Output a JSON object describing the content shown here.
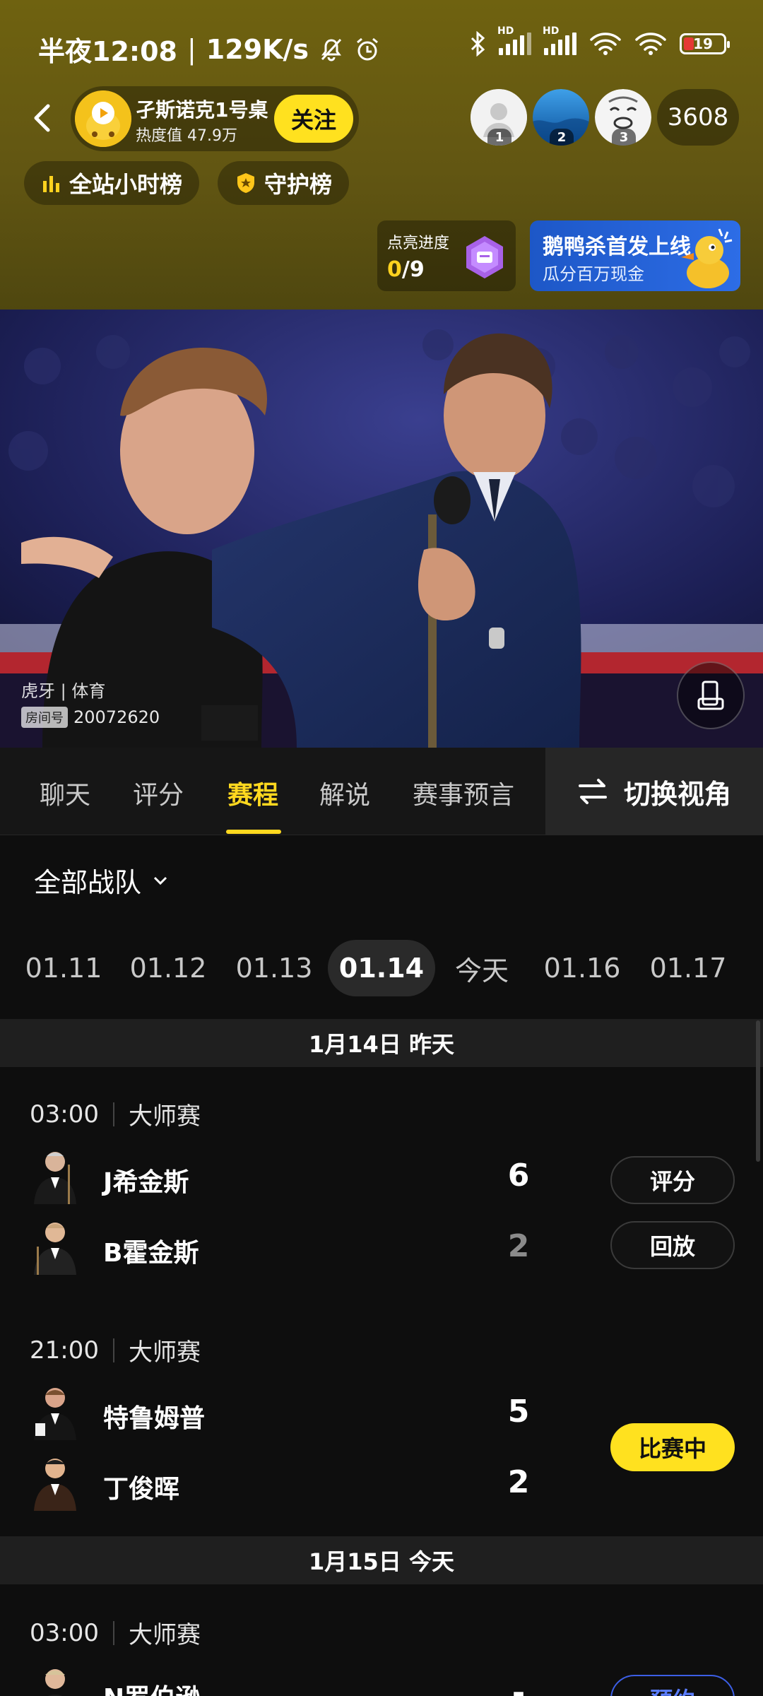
{
  "status_bar": {
    "time": "半夜12:08",
    "net_speed": "129K/s",
    "battery": "19"
  },
  "host": {
    "name": "孑斯诺克1号桌",
    "heat": "热度值 47.9万",
    "follow_label": "关注"
  },
  "viewers": {
    "ranks": [
      "1",
      "2",
      "3"
    ],
    "count": "3608"
  },
  "rank_chips": {
    "hourly": "全站小时榜",
    "guard": "守护榜"
  },
  "lightup": {
    "title": "点亮进度",
    "current": "0",
    "total": "/9"
  },
  "banner": {
    "title": "鹅鸭杀首发上线",
    "subtitle": "瓜分百万现金"
  },
  "video": {
    "label": "虎牙 | 体育",
    "room_tag": "房间号",
    "room_number": "20072620"
  },
  "tabs": [
    "聊天",
    "评分",
    "赛程",
    "解说",
    "赛事预言"
  ],
  "switch_view_label": "切换视角",
  "team_filter": "全部战队",
  "dates": [
    "01.11",
    "01.12",
    "01.13",
    "01.14",
    "今天",
    "01.16",
    "01.17"
  ],
  "days": [
    {
      "header": "1月14日 昨天",
      "matches": [
        {
          "time": "03:00",
          "event": "大师赛",
          "players": [
            {
              "name": "J希金斯",
              "score": "6"
            },
            {
              "name": "B霍金斯",
              "score": "2"
            }
          ],
          "buttons": [
            "评分",
            "回放"
          ]
        },
        {
          "time": "21:00",
          "event": "大师赛",
          "players": [
            {
              "name": "特鲁姆普",
              "score": "5"
            },
            {
              "name": "丁俊晖",
              "score": "2"
            }
          ],
          "status": "比赛中"
        }
      ]
    },
    {
      "header": "1月15日 今天",
      "matches": [
        {
          "time": "03:00",
          "event": "大师赛",
          "players": [
            {
              "name": "N罗伯逊",
              "score": "-"
            }
          ],
          "action": "预约"
        }
      ]
    }
  ],
  "colors": {
    "accent_yellow": "#ffe11f",
    "header_bg": "#625612",
    "page_bg": "#0e0e0e"
  }
}
